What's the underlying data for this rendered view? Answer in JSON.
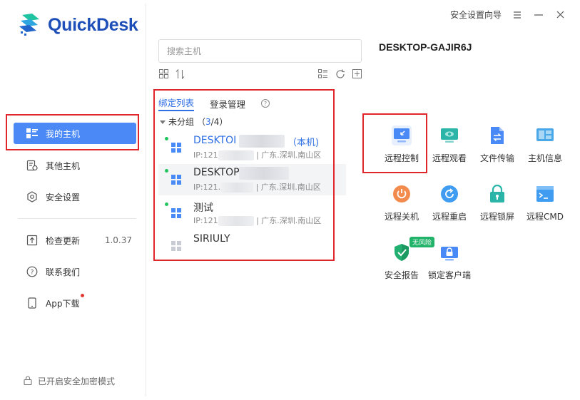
{
  "app": {
    "name": "QuickDesk",
    "brand_color": "#1e4fb8",
    "accent": "#4b8af6"
  },
  "titlebar": {
    "guide_label": "安全设置向导",
    "menu_icon": "hamburger-icon",
    "min_icon": "minimize-icon",
    "close_icon": "close-icon"
  },
  "sidebar": {
    "items": [
      {
        "label": "我的主机",
        "icon": "hosts-icon",
        "active": true
      },
      {
        "label": "其他主机",
        "icon": "other-hosts-icon"
      },
      {
        "label": "安全设置",
        "icon": "shield-settings-icon"
      },
      {
        "label": "检查更新",
        "icon": "update-icon",
        "version": "1.0.37"
      },
      {
        "label": "联系我们",
        "icon": "question-icon"
      },
      {
        "label": "App下载",
        "icon": "phone-icon",
        "notification": true
      }
    ],
    "secure_mode_label": "已开启安全加密模式"
  },
  "hostlist": {
    "search_placeholder": "搜索主机",
    "tabs": [
      {
        "label": "绑定列表",
        "active": true
      },
      {
        "label": "登录管理"
      }
    ],
    "group": {
      "label": "未分组",
      "count_prefix": "（",
      "online": "3",
      "total": "/4）"
    },
    "hosts": [
      {
        "name": "DESKTOI",
        "local_tag": "（本机)",
        "ip": "IP:121",
        "location": "| 广东.深圳.南山区",
        "online": true
      },
      {
        "name": "DESKTOP",
        "ip": "IP:121.",
        "location": "| 广东.深圳.南山区",
        "online": true,
        "selected": true
      },
      {
        "name": "测试",
        "ip": "IP:121",
        "location": "| 广东.深圳.南山区",
        "online": true
      },
      {
        "name": "SIRIULY",
        "online": false
      }
    ]
  },
  "detail": {
    "host_title": "DESKTOP-GAJIR6J",
    "functions": [
      {
        "label": "远程控制",
        "icon": "remote-control-icon",
        "color": "#4a8af6"
      },
      {
        "label": "远程观看",
        "icon": "remote-view-icon",
        "color": "#2bb5a8"
      },
      {
        "label": "文件传输",
        "icon": "file-transfer-icon",
        "color": "#4a8af6"
      },
      {
        "label": "主机信息",
        "icon": "host-info-icon",
        "color": "#4aa8e8"
      },
      {
        "label": "远程关机",
        "icon": "power-icon",
        "color": "#f28b4b"
      },
      {
        "label": "远程重启",
        "icon": "restart-icon",
        "color": "#3f9cf0"
      },
      {
        "label": "远程锁屏",
        "icon": "lock-screen-icon",
        "color": "#2bb5a8"
      },
      {
        "label": "远程CMD",
        "icon": "cmd-icon",
        "color": "#3f9cf0"
      },
      {
        "label": "安全报告",
        "icon": "security-report-icon",
        "color": "#22b070",
        "badge": "无风险"
      },
      {
        "label": "锁定客户端",
        "icon": "lock-client-icon",
        "color": "#4a8af6"
      }
    ]
  }
}
